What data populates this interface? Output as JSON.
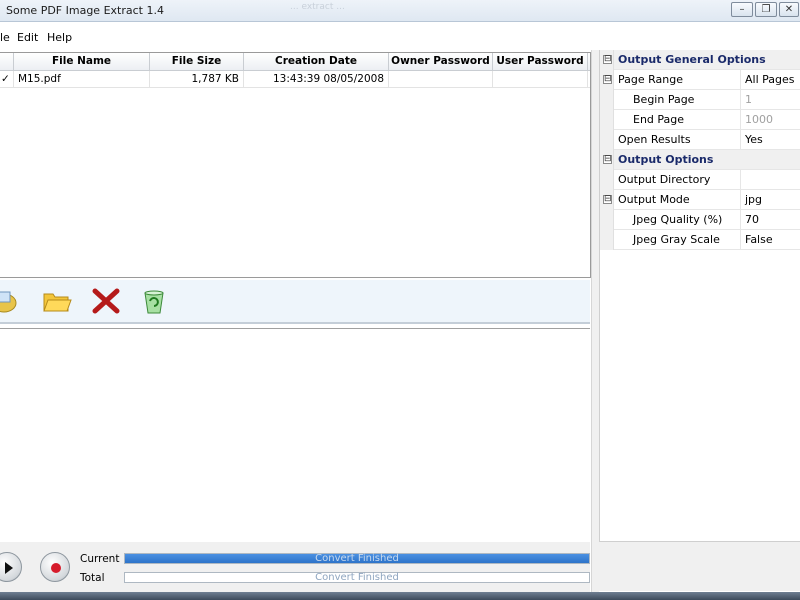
{
  "window": {
    "title": "Some PDF Image Extract 1.4",
    "ghost_text": "... extract ...",
    "buttons": {
      "minimize": "–",
      "restore": "❐",
      "close": "✕"
    }
  },
  "menu": {
    "file": "le",
    "edit": "Edit",
    "help": "Help"
  },
  "file_table": {
    "columns": [
      "File Name",
      "File Size",
      "Creation Date",
      "Owner Password",
      "User Password"
    ],
    "rows": [
      {
        "check": "✓",
        "name": "M15.pdf",
        "size": "1,787 KB",
        "date": "13:43:39 08/05/2008",
        "owner": "",
        "user": ""
      }
    ]
  },
  "toolbar": {
    "icons": [
      "add-pdf-icon",
      "open-folder-icon",
      "delete-icon",
      "recycle-icon"
    ]
  },
  "properties": {
    "general_header": "Output General Options",
    "page_range_label": "Page Range",
    "page_range_value": "All Pages",
    "begin_page_label": "Begin Page",
    "begin_page_value": "1",
    "end_page_label": "End Page",
    "end_page_value": "1000",
    "open_results_label": "Open Results",
    "open_results_value": "Yes",
    "output_header": "Output Options",
    "output_dir_label": "Output Directory",
    "output_dir_value": "",
    "output_mode_label": "Output Mode",
    "output_mode_value": "jpg",
    "jpeg_quality_label": "Jpeg Quality (%)",
    "jpeg_quality_value": "70",
    "jpeg_gray_label": "Jpeg Gray Scale",
    "jpeg_gray_value": "False",
    "collapse_glyph": "⊟"
  },
  "status": {
    "current_label": "Current",
    "total_label": "Total",
    "current_text": "Convert Finished",
    "total_text": "Convert Finished",
    "current_progress": 1.0,
    "total_progress": 0.0
  }
}
